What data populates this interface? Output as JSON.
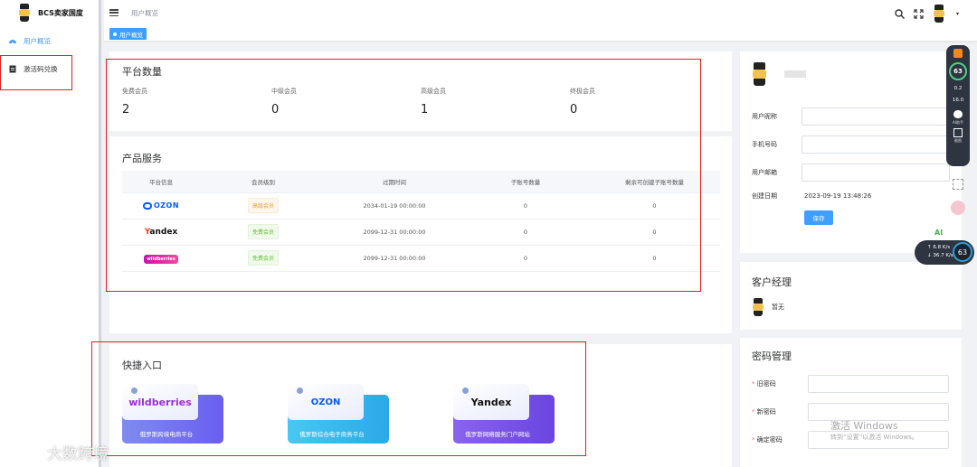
{
  "app": {
    "brand": "BCS卖家国度"
  },
  "sidebar": {
    "items": [
      {
        "label": "用户概览",
        "active": true
      },
      {
        "label": "激活码兑换",
        "active": false
      }
    ]
  },
  "header": {
    "breadcrumb": "用户概览",
    "tab": "用户概览"
  },
  "platform": {
    "title": "平台数量",
    "stats": [
      {
        "label": "免费会员",
        "value": "2"
      },
      {
        "label": "中级会员",
        "value": "0"
      },
      {
        "label": "高级会员",
        "value": "1"
      },
      {
        "label": "终极会员",
        "value": "0"
      }
    ]
  },
  "products": {
    "title": "产品服务",
    "columns": [
      "平台信息",
      "会员级别",
      "过期时间",
      "子账号数量",
      "剩余可创建子账号数量"
    ],
    "rows": [
      {
        "platform": "OZON",
        "level": "高级会员",
        "level_color": "#e6a23c",
        "expire": "2034-01-19 00:00:00",
        "sub": "0",
        "remain": "0"
      },
      {
        "platform": "Yandex",
        "level": "免费会员",
        "level_color": "#67c23a",
        "expire": "2099-12-31 00:00:00",
        "sub": "0",
        "remain": "0"
      },
      {
        "platform": "wildberries",
        "level": "免费会员",
        "level_color": "#67c23a",
        "expire": "2099-12-31 00:00:00",
        "sub": "0",
        "remain": "0"
      }
    ]
  },
  "quick": {
    "title": "快捷入口",
    "entries": [
      {
        "name": "wildberries",
        "caption": "俄罗斯跨境电商平台",
        "color": "#6f73ee"
      },
      {
        "name": "OZON",
        "caption": "俄罗斯综合电子商务平台",
        "color": "#2bb3e9"
      },
      {
        "name": "Yandex",
        "caption": "俄罗斯网络服务门户网站",
        "color": "#7b52e6"
      }
    ]
  },
  "profile": {
    "fields": [
      {
        "label": "用户昵称"
      },
      {
        "label": "手机号码"
      },
      {
        "label": "用户邮箱"
      }
    ],
    "created_label": "创建日期",
    "created_value": "2023-09-19 13:48:26",
    "save": "保存"
  },
  "manager": {
    "title": "客户经理",
    "name": "暂无"
  },
  "password": {
    "title": "密码管理",
    "fields": [
      {
        "label": "旧密码"
      },
      {
        "label": "新密码"
      },
      {
        "label": "确定密码"
      }
    ]
  },
  "widget": {
    "cpu": "63",
    "cpu_unit": "%",
    "net_a": "0.2",
    "net_b": "16.0",
    "unit": "K/s",
    "assistant": "AI助手",
    "screenshot": "截图",
    "ai": "AI",
    "down": "6.8",
    "up": "36.7"
  },
  "watermarks": {
    "activate": "激活 Windows",
    "activate_hint": "转到“设置”以激活 Windows。",
    "corner": "大数跨境"
  }
}
